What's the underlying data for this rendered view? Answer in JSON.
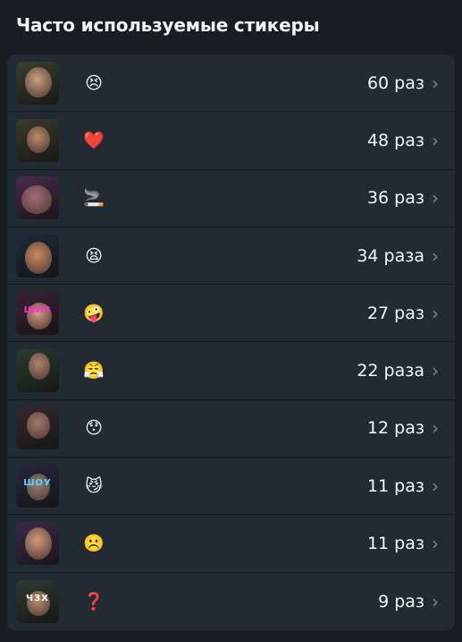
{
  "header": {
    "title": "Часто используемые стикеры"
  },
  "stickers": [
    {
      "emoji": "😣",
      "count": "60 раз",
      "thumb_text": "",
      "bg": "#3a3f2c",
      "face": "#c89f84",
      "text_color": "#ffffff"
    },
    {
      "emoji": "❤️",
      "count": "48 раз",
      "thumb_text": "",
      "bg": "#3b3a2c",
      "face": "#b58a6a",
      "text_color": "#38d6ff"
    },
    {
      "emoji": "🚬",
      "count": "36 раз",
      "thumb_text": "",
      "bg": "#4a2a4c",
      "face": "#a06a7a",
      "text_color": "#ffffff"
    },
    {
      "emoji": "😫",
      "count": "34 раза",
      "thumb_text": "",
      "bg": "#1f2a3a",
      "face": "#c98b63",
      "text_color": "#ffffff"
    },
    {
      "emoji": "🤪",
      "count": "27 раз",
      "thumb_text": "ШИЗ",
      "bg": "#3a2236",
      "face": "#d59a86",
      "text_color": "#ff2bd6"
    },
    {
      "emoji": "😤",
      "count": "22 раза",
      "thumb_text": "",
      "bg": "#2b3b2e",
      "face": "#a88470",
      "text_color": "#ff3333"
    },
    {
      "emoji": "😯",
      "count": "12 раз",
      "thumb_text": "",
      "bg": "#332a2f",
      "face": "#a07a6c",
      "text_color": "#ff2e8a"
    },
    {
      "emoji": "😼",
      "count": "11 раз",
      "thumb_text": "ШОУ",
      "bg": "#25273d",
      "face": "#8f7f7a",
      "text_color": "#5fd0ff"
    },
    {
      "emoji": "☹️",
      "count": "11 раз",
      "thumb_text": "",
      "bg": "#3b2a4a",
      "face": "#d59a82",
      "text_color": "#ffffff"
    },
    {
      "emoji": "❓",
      "count": "9 раз",
      "thumb_text": "ЧЗХ",
      "bg": "#2f3a34",
      "face": "#b48f74",
      "text_color": "#ffffff"
    }
  ],
  "icons": {
    "chevron": "chevron-right-icon"
  }
}
